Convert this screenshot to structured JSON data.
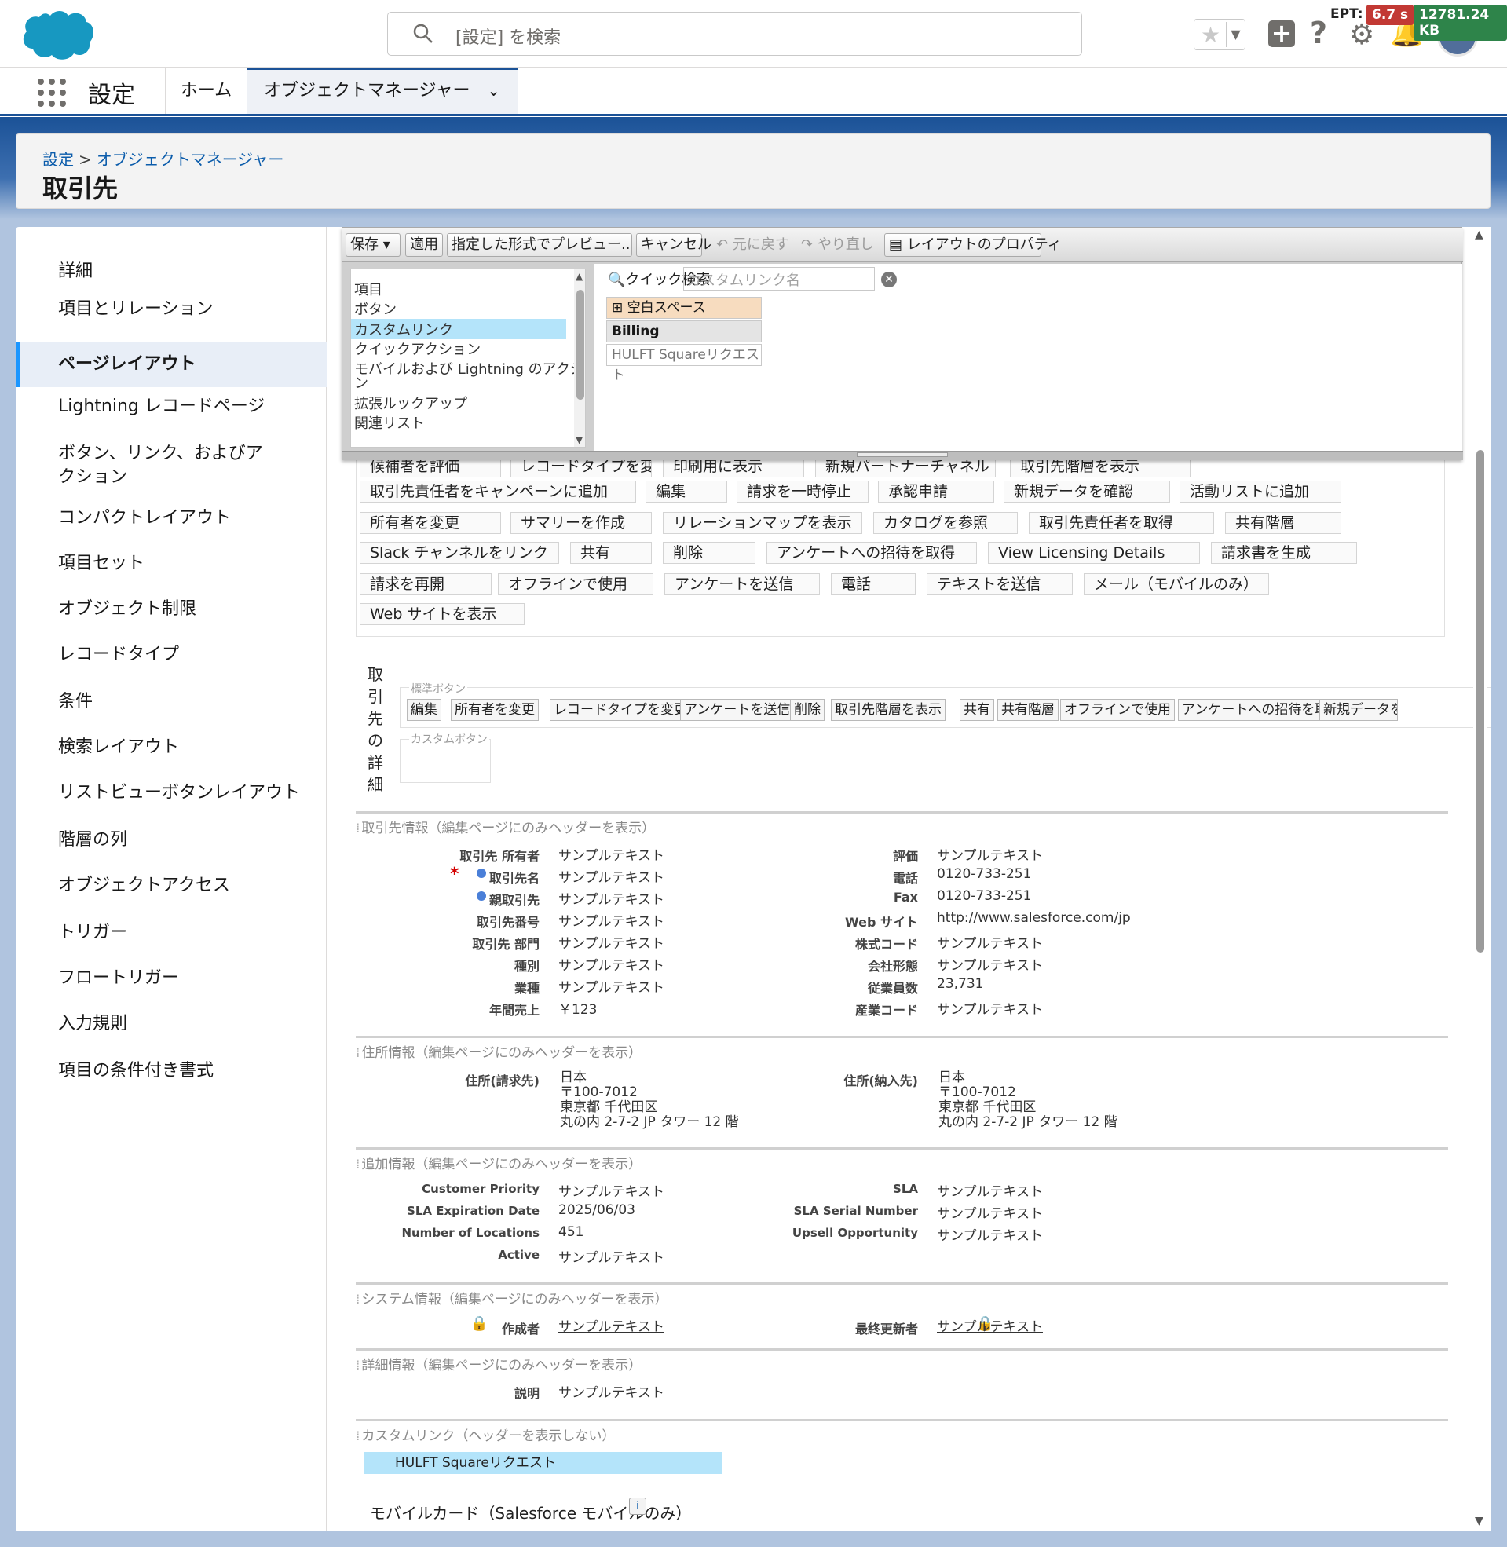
{
  "header": {
    "search_placeholder": "[設定] を検索",
    "ept_label": "EPT:",
    "ept_value": "6.7 s",
    "kb_value": "12781.24 KB",
    "icons": [
      "salesforce-logo",
      "search-icon",
      "star-icon",
      "plus-icon",
      "help-icon",
      "gear-icon",
      "bell-icon",
      "avatar"
    ]
  },
  "nav": {
    "app_name": "設定",
    "tabs": [
      {
        "label": "ホーム"
      },
      {
        "label": "オブジェクトマネージャー"
      }
    ]
  },
  "breadcrumb": {
    "items": [
      "設定",
      "オブジェクトマネージャー"
    ],
    "separator": ">"
  },
  "page_title": "取引先",
  "sidebar": {
    "items": [
      {
        "label": "詳細"
      },
      {
        "label": "項目とリレーション"
      },
      {
        "label": "ページレイアウト",
        "active": true
      },
      {
        "label": "Lightning レコードページ"
      },
      {
        "label": "ボタン、リンク、およびアクション"
      },
      {
        "label": "コンパクトレイアウト"
      },
      {
        "label": "項目セット"
      },
      {
        "label": "オブジェクト制限"
      },
      {
        "label": "レコードタイプ"
      },
      {
        "label": "条件"
      },
      {
        "label": "検索レイアウト"
      },
      {
        "label": "リストビューボタンレイアウト"
      },
      {
        "label": "階層の列"
      },
      {
        "label": "オブジェクトアクセス"
      },
      {
        "label": "トリガー"
      },
      {
        "label": "フロートリガー"
      },
      {
        "label": "入力規則"
      },
      {
        "label": "項目の条件付き書式"
      }
    ]
  },
  "toolbar": {
    "save": "保存",
    "apply": "適用",
    "preview": "指定した形式でプレビュー...",
    "cancel": "キャンセル",
    "undo": "元に戻す",
    "redo": "やり直し",
    "layout_props": "レイアウトのプロパティ"
  },
  "palette": {
    "categories": [
      {
        "label": "項目"
      },
      {
        "label": "ボタン"
      },
      {
        "label": "カスタムリンク",
        "selected": true
      },
      {
        "label": "クイックアクション"
      },
      {
        "label": "モバイルおよび Lightning のアクショ"
      },
      {
        "label": "ン"
      },
      {
        "label": "拡張ルックアップ"
      },
      {
        "label": "関連リスト"
      }
    ],
    "quick_search_label": "クイック検索",
    "quick_search_placeholder": "カスタムリンク名",
    "items": [
      {
        "label": "空白スペース"
      },
      {
        "label": "Billing"
      },
      {
        "label": "HULFT Squareリクエスト"
      }
    ]
  },
  "buttons_partial_row": [
    "候補者を評価",
    "レコードタイプを変更",
    "印刷用に表示",
    "新規パートナーチャネル",
    "取引先階層を表示"
  ],
  "buttons_grid": [
    [
      "取引先責任者をキャンペーンに追加",
      "編集",
      "請求を一時停止",
      "承認申請",
      "新規データを確認",
      "活動リストに追加"
    ],
    [
      "所有者を変更",
      "サマリーを作成",
      "リレーションマップを表示",
      "カタログを参照",
      "取引先責任者を取得",
      "共有階層"
    ],
    [
      "Slack チャンネルをリンク",
      "共有",
      "削除",
      "アンケートへの招待を取得",
      "View Licensing Details",
      "請求書を生成"
    ],
    [
      "請求を再開",
      "オフラインで使用",
      "アンケートを送信",
      "電話",
      "テキストを送信",
      "メール（モバイルのみ）"
    ],
    [
      "Web サイトを表示"
    ]
  ],
  "detail": {
    "vertical_title": [
      "取",
      "引",
      "先",
      "の",
      "詳",
      "細"
    ],
    "standard_buttons_label": "標準ボタン",
    "custom_buttons_label": "カスタムボタン",
    "standard_buttons": [
      "編集",
      "所有者を変更",
      "レコードタイプを変更",
      "アンケートを送信",
      "削除",
      "取引先階層を表示",
      "共有",
      "共有階層",
      "オフラインで使用",
      "アンケートへの招待を取得",
      "新規データを"
    ]
  },
  "sections": {
    "account_info": {
      "title": "取引先情報（編集ページにのみヘッダーを表示）",
      "left": [
        {
          "label": "取引先 所有者",
          "value": "サンプルテキスト",
          "link": true
        },
        {
          "label": "取引先名",
          "value": "サンプルテキスト",
          "required": true,
          "dot": true
        },
        {
          "label": "親取引先",
          "value": "サンプルテキスト",
          "link": true,
          "dot": true
        },
        {
          "label": "取引先番号",
          "value": "サンプルテキスト"
        },
        {
          "label": "取引先 部門",
          "value": "サンプルテキスト"
        },
        {
          "label": "種別",
          "value": "サンプルテキスト"
        },
        {
          "label": "業種",
          "value": "サンプルテキスト"
        },
        {
          "label": "年間売上",
          "value": "￥123"
        }
      ],
      "right": [
        {
          "label": "評価",
          "value": "サンプルテキスト"
        },
        {
          "label": "電話",
          "value": "0120-733-251"
        },
        {
          "label": "Fax",
          "value": "0120-733-251"
        },
        {
          "label": "Web サイト",
          "value": "http://www.salesforce.com/jp"
        },
        {
          "label": "株式コード",
          "value": "サンプルテキスト",
          "link": true
        },
        {
          "label": "会社形態",
          "value": "サンプルテキスト"
        },
        {
          "label": "従業員数",
          "value": "23,731"
        },
        {
          "label": "産業コード",
          "value": "サンプルテキスト"
        }
      ]
    },
    "address_info": {
      "title": "住所情報（編集ページにのみヘッダーを表示）",
      "billing_label": "住所(請求先)",
      "billing_lines": [
        "日本",
        "〒100-7012",
        "東京都 千代田区",
        "丸の内 2-7-2 JP タワー 12 階"
      ],
      "shipping_label": "住所(納入先)",
      "shipping_lines": [
        "日本",
        "〒100-7012",
        "東京都 千代田区",
        "丸の内 2-7-2 JP タワー 12 階"
      ]
    },
    "additional_info": {
      "title": "追加情報（編集ページにのみヘッダーを表示）",
      "left": [
        {
          "label": "Customer Priority",
          "value": "サンプルテキスト"
        },
        {
          "label": "SLA Expiration Date",
          "value": "2025/06/03"
        },
        {
          "label": "Number of Locations",
          "value": "451"
        },
        {
          "label": "Active",
          "value": "サンプルテキスト"
        }
      ],
      "right": [
        {
          "label": "SLA",
          "value": "サンプルテキスト"
        },
        {
          "label": "SLA Serial Number",
          "value": "サンプルテキスト"
        },
        {
          "label": "Upsell Opportunity",
          "value": "サンプルテキスト"
        }
      ]
    },
    "system_info": {
      "title": "システム情報（編集ページにのみヘッダーを表示）",
      "created_by_label": "作成者",
      "created_by_value": "サンプルテキスト",
      "modified_by_label": "最終更新者",
      "modified_by_value": "サンプルテキスト"
    },
    "description_info": {
      "title": "詳細情報（編集ページにのみヘッダーを表示）",
      "label": "説明",
      "value": "サンプルテキスト"
    },
    "custom_links": {
      "title": "カスタムリンク（ヘッダーを表示しない）",
      "item": "HULFT Squareリクエスト"
    }
  },
  "mobile_cards_title": "モバイルカード（Salesforce モバイルのみ）",
  "colors": {
    "brand_blue": "#1b5297",
    "link": "#0b5cab",
    "selected": "#b4e4fa",
    "ept_red": "#c23934",
    "kb_green": "#2e844a"
  }
}
